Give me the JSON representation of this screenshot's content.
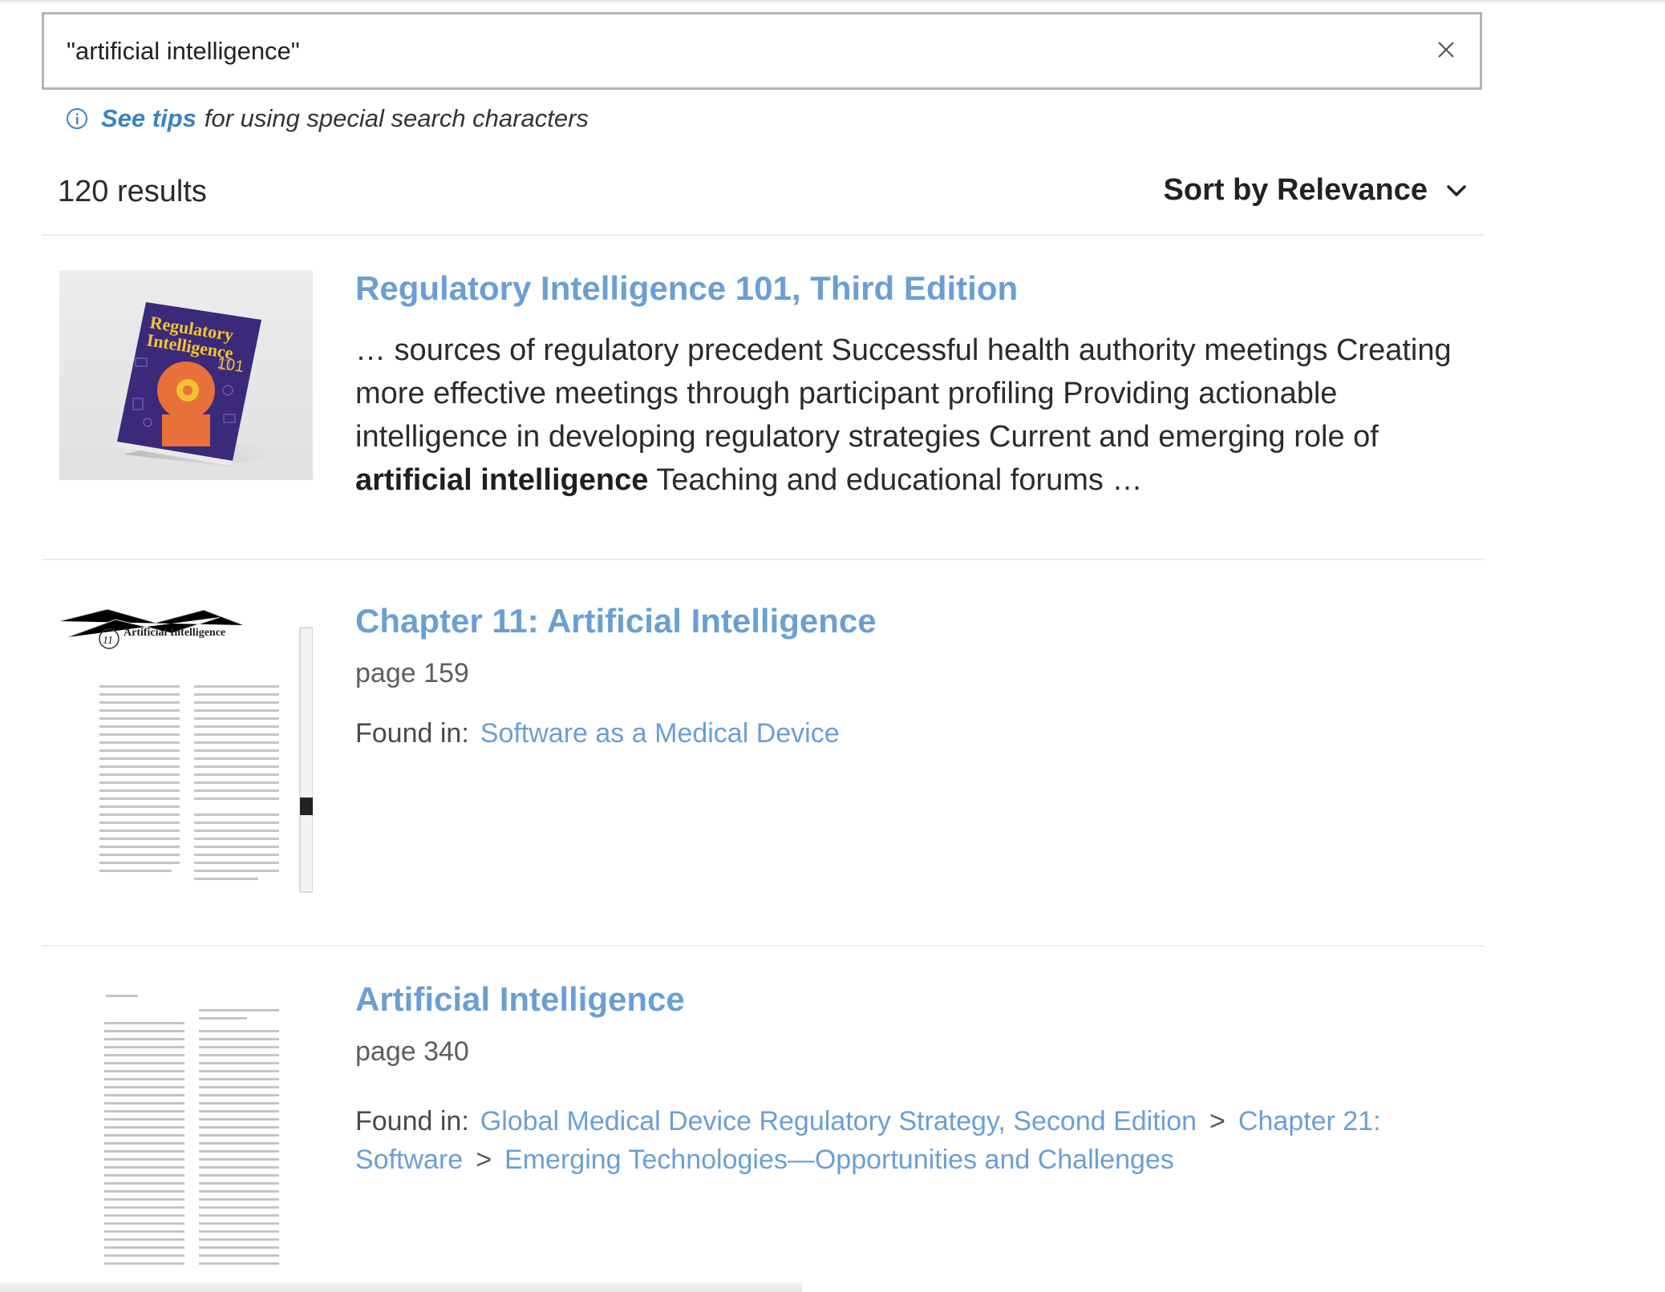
{
  "search": {
    "value": "\"artificial intelligence\"",
    "clear_icon": "close-icon"
  },
  "tips": {
    "icon": "info-icon",
    "link": "See tips",
    "rest": "for using special search characters"
  },
  "results_bar": {
    "count": "120 results",
    "sort_label": "Sort by Relevance",
    "sort_icon": "chevron-down-icon"
  },
  "results": [
    {
      "title": "Regulatory Intelligence 101, Third Edition",
      "snippet_before": "… sources of regulatory precedent Successful health authority meetings  Creating more effective meetings through participant profiling Providing actionable intelligence in developing regulatory strategies Current and emerging role of ",
      "snippet_bold": "artificial intelligence",
      "snippet_after": " Teaching and educational forums …",
      "cover_title_line1": "Regulatory",
      "cover_title_line2": "Intelligence",
      "cover_number": "101"
    },
    {
      "title": "Chapter 11: Artificial Intelligence",
      "page": "page 159",
      "found_label": "Found in:",
      "found_path": [
        "Software as a Medical Device"
      ],
      "thumb_chapter": "11",
      "thumb_heading": "Artificial Intelligence"
    },
    {
      "title": "Artificial Intelligence",
      "page": "page 340",
      "found_label": "Found in:",
      "found_path": [
        "Global Medical Device Regulatory Strategy, Second Edition",
        "Chapter 21: Software",
        "Emerging Technologies—Opportunities and Challenges"
      ],
      "found_separator": ">"
    }
  ],
  "colors": {
    "link": "#6a9fd4",
    "tips_link": "#3a82c4",
    "cover_purple": "#3b2a7a",
    "cover_yellow": "#f2c230",
    "cover_orange": "#e8703a"
  }
}
